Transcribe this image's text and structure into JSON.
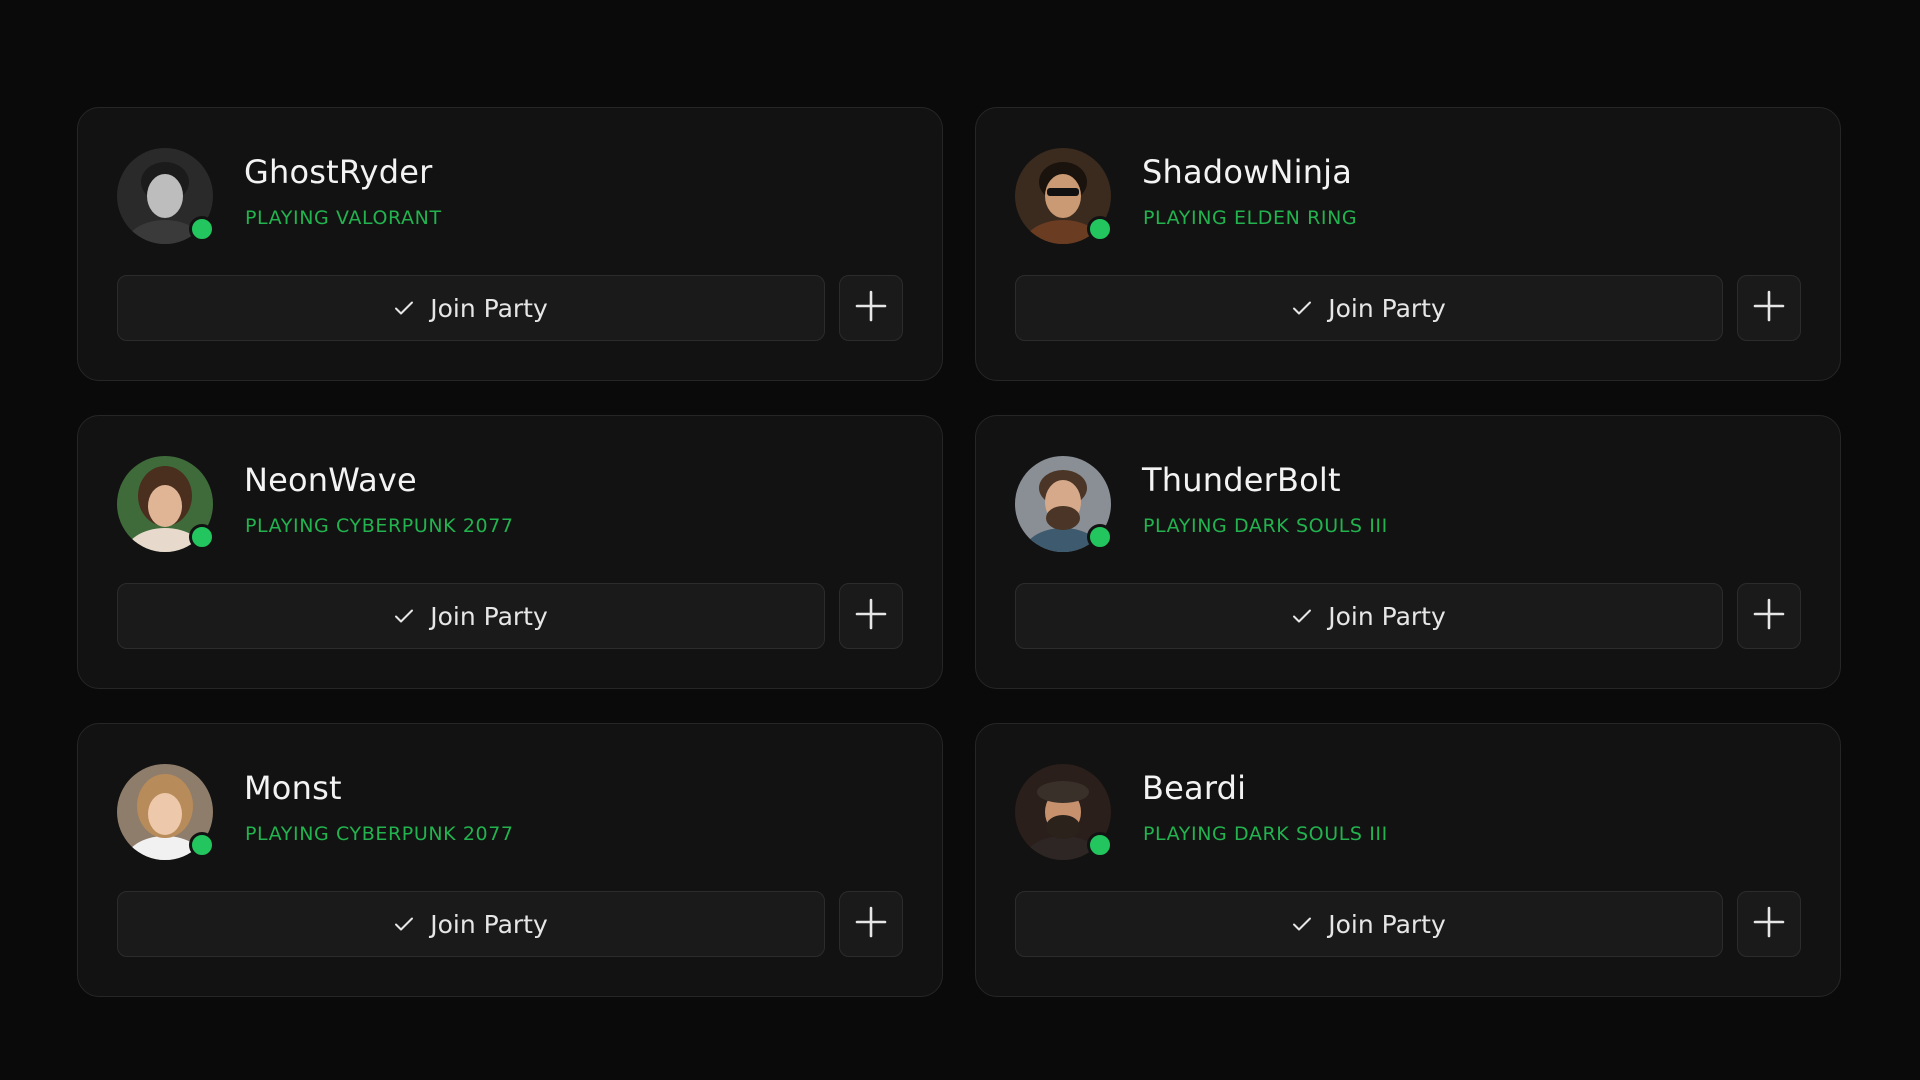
{
  "colors": {
    "background": "#0a0a0a",
    "card": "#121212",
    "accent_green": "#22c55e",
    "activity_text": "#22b34f"
  },
  "friends": [
    {
      "name": "GhostRyder",
      "activity": "PLAYING VALORANT",
      "status": "online",
      "join_label": "Join Party",
      "join_icon": "check-icon",
      "add_icon": "plus-icon",
      "avatar": {
        "bg": "#2a2a2a",
        "hair": "#1b1b1b",
        "skin": "#bdbdbd",
        "shirt": "#3a3a3a"
      }
    },
    {
      "name": "ShadowNinja",
      "activity": "PLAYING ELDEN RING",
      "status": "online",
      "join_label": "Join Party",
      "join_icon": "check-icon",
      "add_icon": "plus-icon",
      "avatar": {
        "bg": "#3b2a1e",
        "hair": "#1a120c",
        "skin": "#c99a74",
        "shirt": "#6a3c22"
      }
    },
    {
      "name": "NeonWave",
      "activity": "PLAYING CYBERPUNK 2077",
      "status": "online",
      "join_label": "Join Party",
      "join_icon": "check-icon",
      "add_icon": "plus-icon",
      "avatar": {
        "bg": "#3f6b3a",
        "hair": "#4a2e1e",
        "skin": "#e0b596",
        "shirt": "#e7d9cc"
      }
    },
    {
      "name": "ThunderBolt",
      "activity": "PLAYING DARK SOULS III",
      "status": "online",
      "join_label": "Join Party",
      "join_icon": "check-icon",
      "add_icon": "plus-icon",
      "avatar": {
        "bg": "#8a8f96",
        "hair": "#4a3526",
        "skin": "#d6a98a",
        "shirt": "#3d5a6e"
      }
    },
    {
      "name": "Monst",
      "activity": "PLAYING CYBERPUNK 2077",
      "status": "online",
      "join_label": "Join Party",
      "join_icon": "check-icon",
      "add_icon": "plus-icon",
      "avatar": {
        "bg": "#8f7d6b",
        "hair": "#b88b5a",
        "skin": "#edc8aa",
        "shirt": "#f1f1f1"
      }
    },
    {
      "name": "Beardi",
      "activity": "PLAYING DARK SOULS III",
      "status": "online",
      "join_label": "Join Party",
      "join_icon": "check-icon",
      "add_icon": "plus-icon",
      "avatar": {
        "bg": "#2a1f1a",
        "hair": "#2b221c",
        "skin": "#c7916e",
        "shirt": "#2e2624"
      }
    }
  ]
}
